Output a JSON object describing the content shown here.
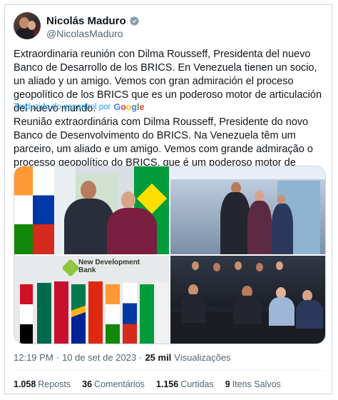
{
  "author": {
    "name": "Nicolás Maduro",
    "handle": "@NicolasMaduro",
    "verified_icon": "verified-badge-icon"
  },
  "post": {
    "text_original": "Extraordinaria reunión con Dilma Rousseff, Presidenta del nuevo Banco de Desarrollo de los BRICS. En Venezuela tienen un socio, un aliado y un amigo. Vemos con gran admiración el proceso geopolítico de los BRICS que es un poderoso motor de articulación del nuevo mundo.",
    "translated_label": "Traduzido do espanhol por",
    "translator_brand": "Google",
    "text_translated": "Reunião extraordinária com Dilma Rousseff, Presidente do novo Banco de Desenvolvimento do BRICS. Na Venezuela têm um parceiro, um aliado e um amigo. Vemos com grande admiração o processo geopolítico do BRICS, que é um poderoso motor de articulação do novo mundo.",
    "media_text": "New Development Bank"
  },
  "meta": {
    "time": "12:19 PM",
    "separator": "·",
    "date": "10 de set de 2023",
    "views_count": "25 mil",
    "views_label": "Visualizações"
  },
  "stats": [
    {
      "count": "1.058",
      "label": "Reposts"
    },
    {
      "count": "36",
      "label": "Comentários"
    },
    {
      "count": "1.156",
      "label": "Curtidas"
    },
    {
      "count": "9",
      "label": "Itens Salvos"
    }
  ],
  "colors": {
    "link": "#1d9bf0",
    "secondary": "#536471",
    "border": "#cfd9de"
  }
}
